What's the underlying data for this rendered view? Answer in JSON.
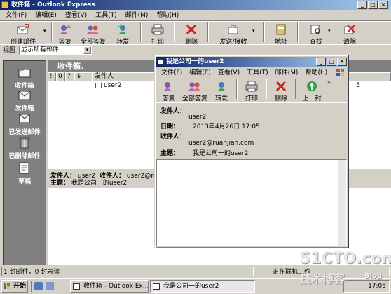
{
  "main": {
    "title": "收件箱 - Outlook Express",
    "menu": [
      "文件(F)",
      "编辑(E)",
      "查看(V)",
      "工具(T)",
      "邮件(M)",
      "帮助(H)"
    ],
    "toolbar": {
      "create": "创建邮件",
      "reply": "答复",
      "reply_all": "全部答复",
      "forward": "转发",
      "print": "打印",
      "delete": "删除",
      "send_receive": "发送/接收",
      "address": "地址",
      "find": "查找",
      "purge": "清除"
    },
    "view_label": "视图",
    "view_value": "显示所有邮件",
    "folders_title": "收件箱．",
    "sidebar": [
      {
        "label": "收件箱"
      },
      {
        "label": "发件箱"
      },
      {
        "label": "已发送邮件"
      },
      {
        "label": "已删除邮件"
      },
      {
        "label": "草稿"
      }
    ],
    "columns": [
      "!",
      "0",
      "?",
      "↓",
      "发件人"
    ],
    "messages": [
      {
        "from": "user2",
        "date_fragment": "5"
      }
    ],
    "preview": {
      "from_label": "发件人：",
      "from_value": "user2",
      "to_label": "收件人：",
      "to_value": "user2@ruanj",
      "subject_label": "主题：",
      "subject_value": "我是公司一的user2"
    },
    "status": {
      "left": "1 封邮件，0 封未读",
      "right": "正在联机工作"
    }
  },
  "message_window": {
    "title": "我是公司一的user2",
    "menu": [
      "文件(F)",
      "编辑(E)",
      "查看(V)",
      "工具(T)",
      "邮件(M)",
      "帮助(H)"
    ],
    "toolbar": {
      "reply": "答复",
      "reply_all": "全部答复",
      "forward": "转发",
      "print": "打印",
      "delete": "删除",
      "previous": "上一封"
    },
    "headers": {
      "from_label": "发件人：",
      "from_value": "user2",
      "date_label": "日期：",
      "date_value": "2013年4月26日 17:05",
      "to_label": "收件人：",
      "to_value": "user2@ruanjian.com",
      "subject_label": "主题：",
      "subject_value": "我是公司一的user2"
    }
  },
  "taskbar": {
    "start": "开始",
    "tasks": [
      "收件箱 - Outlook Ex...",
      "我是公司一的user2"
    ],
    "clock": "17:05"
  },
  "watermark": {
    "site": "51CTO.com",
    "tagline": "技术博客",
    "blog": "Blog"
  },
  "colors": {
    "titlebar": "#0a246a",
    "face": "#d4d0c8",
    "outlook_bar": "#808080"
  }
}
